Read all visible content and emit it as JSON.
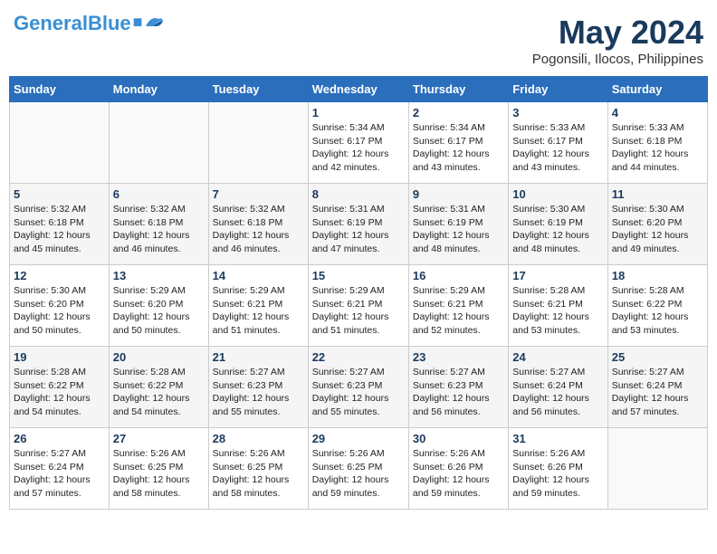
{
  "logo": {
    "part1": "General",
    "part2": "Blue"
  },
  "title": {
    "month_year": "May 2024",
    "location": "Pogonsili, Ilocos, Philippines"
  },
  "days_header": [
    "Sunday",
    "Monday",
    "Tuesday",
    "Wednesday",
    "Thursday",
    "Friday",
    "Saturday"
  ],
  "weeks": [
    [
      {
        "day": "",
        "info": ""
      },
      {
        "day": "",
        "info": ""
      },
      {
        "day": "",
        "info": ""
      },
      {
        "day": "1",
        "info": "Sunrise: 5:34 AM\nSunset: 6:17 PM\nDaylight: 12 hours\nand 42 minutes."
      },
      {
        "day": "2",
        "info": "Sunrise: 5:34 AM\nSunset: 6:17 PM\nDaylight: 12 hours\nand 43 minutes."
      },
      {
        "day": "3",
        "info": "Sunrise: 5:33 AM\nSunset: 6:17 PM\nDaylight: 12 hours\nand 43 minutes."
      },
      {
        "day": "4",
        "info": "Sunrise: 5:33 AM\nSunset: 6:18 PM\nDaylight: 12 hours\nand 44 minutes."
      }
    ],
    [
      {
        "day": "5",
        "info": "Sunrise: 5:32 AM\nSunset: 6:18 PM\nDaylight: 12 hours\nand 45 minutes."
      },
      {
        "day": "6",
        "info": "Sunrise: 5:32 AM\nSunset: 6:18 PM\nDaylight: 12 hours\nand 46 minutes."
      },
      {
        "day": "7",
        "info": "Sunrise: 5:32 AM\nSunset: 6:18 PM\nDaylight: 12 hours\nand 46 minutes."
      },
      {
        "day": "8",
        "info": "Sunrise: 5:31 AM\nSunset: 6:19 PM\nDaylight: 12 hours\nand 47 minutes."
      },
      {
        "day": "9",
        "info": "Sunrise: 5:31 AM\nSunset: 6:19 PM\nDaylight: 12 hours\nand 48 minutes."
      },
      {
        "day": "10",
        "info": "Sunrise: 5:30 AM\nSunset: 6:19 PM\nDaylight: 12 hours\nand 48 minutes."
      },
      {
        "day": "11",
        "info": "Sunrise: 5:30 AM\nSunset: 6:20 PM\nDaylight: 12 hours\nand 49 minutes."
      }
    ],
    [
      {
        "day": "12",
        "info": "Sunrise: 5:30 AM\nSunset: 6:20 PM\nDaylight: 12 hours\nand 50 minutes."
      },
      {
        "day": "13",
        "info": "Sunrise: 5:29 AM\nSunset: 6:20 PM\nDaylight: 12 hours\nand 50 minutes."
      },
      {
        "day": "14",
        "info": "Sunrise: 5:29 AM\nSunset: 6:21 PM\nDaylight: 12 hours\nand 51 minutes."
      },
      {
        "day": "15",
        "info": "Sunrise: 5:29 AM\nSunset: 6:21 PM\nDaylight: 12 hours\nand 51 minutes."
      },
      {
        "day": "16",
        "info": "Sunrise: 5:29 AM\nSunset: 6:21 PM\nDaylight: 12 hours\nand 52 minutes."
      },
      {
        "day": "17",
        "info": "Sunrise: 5:28 AM\nSunset: 6:21 PM\nDaylight: 12 hours\nand 53 minutes."
      },
      {
        "day": "18",
        "info": "Sunrise: 5:28 AM\nSunset: 6:22 PM\nDaylight: 12 hours\nand 53 minutes."
      }
    ],
    [
      {
        "day": "19",
        "info": "Sunrise: 5:28 AM\nSunset: 6:22 PM\nDaylight: 12 hours\nand 54 minutes."
      },
      {
        "day": "20",
        "info": "Sunrise: 5:28 AM\nSunset: 6:22 PM\nDaylight: 12 hours\nand 54 minutes."
      },
      {
        "day": "21",
        "info": "Sunrise: 5:27 AM\nSunset: 6:23 PM\nDaylight: 12 hours\nand 55 minutes."
      },
      {
        "day": "22",
        "info": "Sunrise: 5:27 AM\nSunset: 6:23 PM\nDaylight: 12 hours\nand 55 minutes."
      },
      {
        "day": "23",
        "info": "Sunrise: 5:27 AM\nSunset: 6:23 PM\nDaylight: 12 hours\nand 56 minutes."
      },
      {
        "day": "24",
        "info": "Sunrise: 5:27 AM\nSunset: 6:24 PM\nDaylight: 12 hours\nand 56 minutes."
      },
      {
        "day": "25",
        "info": "Sunrise: 5:27 AM\nSunset: 6:24 PM\nDaylight: 12 hours\nand 57 minutes."
      }
    ],
    [
      {
        "day": "26",
        "info": "Sunrise: 5:27 AM\nSunset: 6:24 PM\nDaylight: 12 hours\nand 57 minutes."
      },
      {
        "day": "27",
        "info": "Sunrise: 5:26 AM\nSunset: 6:25 PM\nDaylight: 12 hours\nand 58 minutes."
      },
      {
        "day": "28",
        "info": "Sunrise: 5:26 AM\nSunset: 6:25 PM\nDaylight: 12 hours\nand 58 minutes."
      },
      {
        "day": "29",
        "info": "Sunrise: 5:26 AM\nSunset: 6:25 PM\nDaylight: 12 hours\nand 59 minutes."
      },
      {
        "day": "30",
        "info": "Sunrise: 5:26 AM\nSunset: 6:26 PM\nDaylight: 12 hours\nand 59 minutes."
      },
      {
        "day": "31",
        "info": "Sunrise: 5:26 AM\nSunset: 6:26 PM\nDaylight: 12 hours\nand 59 minutes."
      },
      {
        "day": "",
        "info": ""
      }
    ]
  ]
}
